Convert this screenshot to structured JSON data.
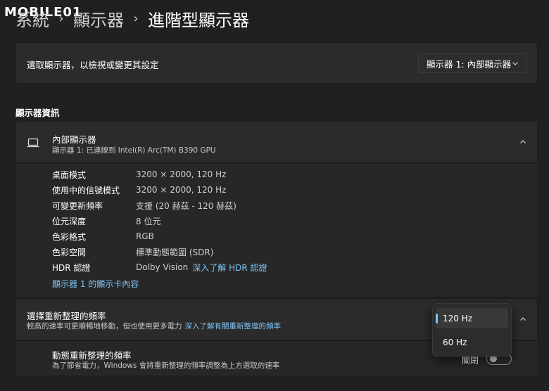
{
  "watermark": "MOBILE01",
  "breadcrumb": {
    "items": [
      "系統",
      "顯示器",
      "進階型顯示器"
    ],
    "separator": "›"
  },
  "display_select": {
    "label": "選取顯示器，以檢視或變更其設定",
    "dropdown_value": "顯示器 1: 內部顯示器"
  },
  "section_title": "顯示器資訊",
  "display_info": {
    "icon": "monitor-icon",
    "name": "內部顯示器",
    "subtitle": "顯示器 1: 已連線到 Intel(R) Arc(TM) B390 GPU",
    "specs": [
      {
        "label": "桌面模式",
        "value": "3200 × 2000, 120 Hz"
      },
      {
        "label": "使用中的信號模式",
        "value": "3200 × 2000, 120 Hz"
      },
      {
        "label": "可變更新頻率",
        "value": "支援 (20 赫茲 - 120 赫茲)"
      },
      {
        "label": "位元深度",
        "value": "8 位元"
      },
      {
        "label": "色彩格式",
        "value": "RGB"
      },
      {
        "label": "色彩空間",
        "value": "標準動態範圍 (SDR)"
      },
      {
        "label": "HDR 認證",
        "value": "Dolby Vision",
        "link": "深入了解 HDR 認證"
      }
    ],
    "adapter_link": "顯示器 1 的顯示卡內容"
  },
  "refresh_rate": {
    "title": "選擇重新整理的頻率",
    "subtitle": "較高的速率可更順暢地移動，但也使用更多電力",
    "link": "深入了解有關重新整理的頻率",
    "options": [
      "120 Hz",
      "60 Hz"
    ],
    "selected": "120 Hz"
  },
  "dynamic_refresh": {
    "title": "動態重新整理的頻率",
    "subtitle": "為了節省電力，Windows 會將重新整理的頻率調整為上方選取的速率",
    "toggle_label": "關閉",
    "toggle_on": false
  },
  "colors": {
    "background": "#202020",
    "card": "#2b2b2b",
    "accent": "#7fc4f5"
  }
}
